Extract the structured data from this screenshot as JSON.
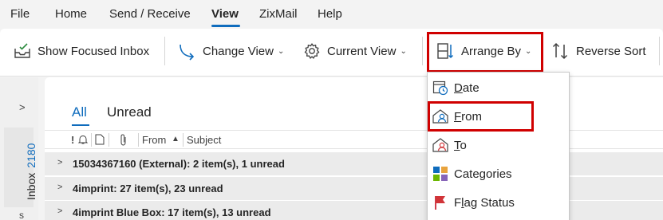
{
  "menu": {
    "tabs": [
      "File",
      "Home",
      "Send / Receive",
      "View",
      "ZixMail",
      "Help"
    ],
    "active": "View"
  },
  "ribbon": {
    "show_focused_inbox": "Show Focused Inbox",
    "change_view": "Change View",
    "current_view": "Current View",
    "arrange_by": "Arrange By",
    "reverse_sort": "Reverse Sort"
  },
  "arrange_menu": {
    "items": [
      {
        "key": "D",
        "rest": "ate",
        "icon": "calendar-clock-icon"
      },
      {
        "key": "F",
        "rest": "rom",
        "icon": "person-from-icon"
      },
      {
        "key": "T",
        "rest": "o",
        "icon": "person-to-icon"
      },
      {
        "key": "",
        "rest": "Categories",
        "icon": "categories-icon"
      },
      {
        "pre": "F",
        "key": "l",
        "rest": "ag Status",
        "icon": "flag-icon"
      }
    ]
  },
  "folder": {
    "name": "Inbox",
    "count": "2180",
    "filters": [
      "All",
      "Unread"
    ],
    "columns": {
      "from": "From",
      "subject": "Subject"
    }
  },
  "groups": [
    "15034367160 (External): 2 item(s), 1 unread",
    "4imprint: 27 item(s), 23 unread",
    "4imprint Blue Box: 17 item(s), 13 unread"
  ],
  "colors": {
    "accent": "#0f6cbd",
    "highlight": "#d00000"
  }
}
